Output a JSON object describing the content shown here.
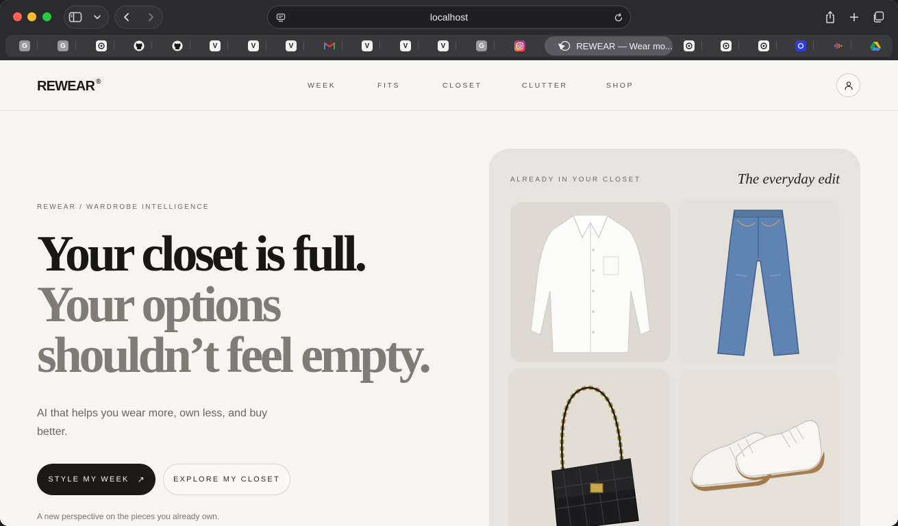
{
  "browser": {
    "url": "localhost",
    "active_tab_title": "REWEAR — Wear mo...",
    "tabs": [
      {
        "icon": "google-icon",
        "glyph": "G"
      },
      {
        "icon": "google-icon",
        "glyph": "G"
      },
      {
        "icon": "openai-icon"
      },
      {
        "icon": "github-icon"
      },
      {
        "icon": "github-icon"
      },
      {
        "icon": "v-icon",
        "glyph": "V"
      },
      {
        "icon": "v-icon",
        "glyph": "V"
      },
      {
        "icon": "v-icon",
        "glyph": "V"
      },
      {
        "icon": "gmail-icon"
      },
      {
        "icon": "v-icon",
        "glyph": "V"
      },
      {
        "icon": "v-icon",
        "glyph": "V"
      },
      {
        "icon": "v-icon",
        "glyph": "V"
      },
      {
        "icon": "google-icon",
        "glyph": "G"
      },
      {
        "icon": "instagram-icon"
      },
      {
        "icon": "openai-icon"
      },
      {
        "icon": "openai-icon"
      },
      {
        "icon": "openai-icon"
      },
      {
        "icon": "blue-circle-icon"
      },
      {
        "icon": "podcast-icon"
      },
      {
        "icon": "google-drive-icon"
      }
    ]
  },
  "site": {
    "logo": "REWEAR",
    "logo_mark": "®",
    "nav": [
      "WEEK",
      "FITS",
      "CLOSET",
      "CLUTTER",
      "SHOP"
    ],
    "account_icon": "user-icon"
  },
  "hero": {
    "eyebrow": "REWEAR / WARDROBE INTELLIGENCE",
    "headline_line1": "Your closet is full.",
    "headline_line2": "Your options",
    "headline_line3": "shouldn’t feel empty.",
    "subtext": "AI that helps you wear more, own less, and buy better.",
    "primary_button": "STYLE MY WEEK",
    "primary_arrow": "↗",
    "secondary_button": "EXPLORE MY CLOSET",
    "footnote": "A new perspective on the pieces you already own."
  },
  "closet_card": {
    "eyebrow": "ALREADY IN YOUR CLOSET",
    "title": "The everyday edit",
    "items": [
      "white-shirt",
      "blue-jeans",
      "black-quilted-bag",
      "white-sneakers"
    ]
  },
  "colors": {
    "page_bg": "#f6f5f1",
    "ink": "#181715",
    "muted_headline": "#807b73",
    "card_bg": "#e7e4dd",
    "chrome_bg": "#2b2b2e"
  }
}
